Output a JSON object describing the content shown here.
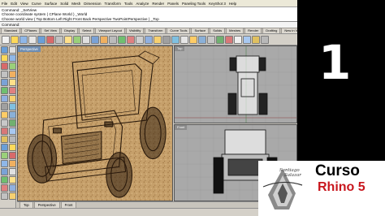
{
  "menubar": {
    "items": [
      "File",
      "Edit",
      "View",
      "Curve",
      "Surface",
      "Solid",
      "Mesh",
      "Dimension",
      "Transform",
      "Tools",
      "Analyze",
      "Render",
      "Panels",
      "Paneling Tools",
      "KeyShot 3",
      "Help"
    ]
  },
  "command": {
    "history": [
      "Command: _SetView",
      "Choose coordinate system ( CPlane  World ) _World",
      "Choose world view ( Top  Bottom  Left  Right  Front  Back  Perspective  TwoPointPerspective ) _Top"
    ],
    "prompt": "Command:"
  },
  "toolbar_tabs": [
    "Standard",
    "CPlanes",
    "Set View",
    "Display",
    "Select",
    "Viewport Layout",
    "Visibility",
    "Transform",
    "Curve Tools",
    "Surface",
    "Solids",
    "Meshes",
    "Render",
    "Drafting",
    "New in V5",
    "Project Rhinos"
  ],
  "viewports": {
    "perspective_title": "Perspective",
    "top_title": "Top",
    "front_title": "Front"
  },
  "viewport_tabs": [
    "Top",
    "Perspective",
    "Front"
  ],
  "overlay": {
    "number": "1",
    "logo_line1": "Santiago",
    "logo_line2": "Salazar",
    "title_line1": "Curso",
    "title_line2": "Rhino 5"
  },
  "colors": {
    "accent_red": "#c8161d",
    "cork": "#c6a06b",
    "viewport_gray": "#a9a9a9"
  }
}
